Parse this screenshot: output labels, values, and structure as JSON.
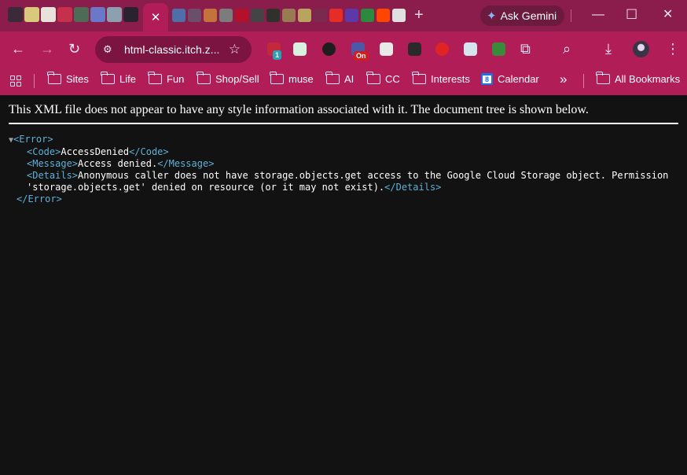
{
  "tabstrip": {
    "tab_favicons": [
      "#3b2a3a",
      "#d9c97a",
      "#e8e2da",
      "#c5304a",
      "#4d6b55",
      "#6b78c9",
      "#8da0b0",
      "#2b2230"
    ],
    "active_tab_close": "✕",
    "more_favicons": [
      "#4f6fa8",
      "#6a4e6a",
      "#c4733b",
      "#7c7c7c",
      "#b3102b",
      "#444444",
      "#30302d",
      "#9a7a52",
      "#b9a45e",
      "#7a2a4d",
      "#e52d27",
      "#5b39a8",
      "#2b8a3e",
      "#ff4500",
      "#e0e0e0"
    ],
    "new_tab": "+",
    "ask_gemini": "Ask Gemini",
    "minimize": "—",
    "maximize": "☐",
    "close": "✕"
  },
  "toolbar": {
    "back": "←",
    "forward": "→",
    "reload": "↻",
    "url": "html-classic.itch.z...",
    "extensions": [
      {
        "color": "#c3283c",
        "badge": "1",
        "badge_color": "#2aa0b8"
      },
      {
        "color": "#d9efe0",
        "badge": "",
        "badge_color": ""
      },
      {
        "color": "#1e1e1e",
        "badge": "",
        "badge_color": ""
      },
      {
        "color": "#4a5aa8",
        "badge": "On",
        "badge_color": "#d21d1d"
      },
      {
        "color": "#e8e8e8",
        "badge": "",
        "badge_color": ""
      },
      {
        "color": "#2a2a2a",
        "badge": "",
        "badge_color": ""
      },
      {
        "color": "#e02424",
        "badge": "",
        "badge_color": ""
      },
      {
        "color": "#d6e4f0",
        "badge": "",
        "badge_color": ""
      },
      {
        "color": "#3a8a3a",
        "badge": "",
        "badge_color": ""
      }
    ]
  },
  "bookmarks": {
    "items": [
      "Sites",
      "Life",
      "Fun",
      "Shop/Sell",
      "muse",
      "AI",
      "CC",
      "Interests",
      "Calendar"
    ],
    "calendar_day": "8",
    "more": "»",
    "all_bookmarks": "All Bookmarks"
  },
  "page": {
    "notice": "This XML file does not appear to have any style information associated with it. The document tree is shown below.",
    "collapse_triangle": "▼",
    "error_open": "<Error>",
    "code_open": "<Code>",
    "code_value": "AccessDenied",
    "code_close": "</Code>",
    "message_open": "<Message>",
    "message_value": "Access denied.",
    "message_close": "</Message>",
    "details_open": "<Details>",
    "details_line1": "Anonymous caller does not have storage.objects.get access to the Google Cloud Storage object. Permission",
    "details_line2": "'storage.objects.get' denied on resource (or it may not exist).",
    "details_close": "</Details>",
    "error_close": "</Error>"
  }
}
